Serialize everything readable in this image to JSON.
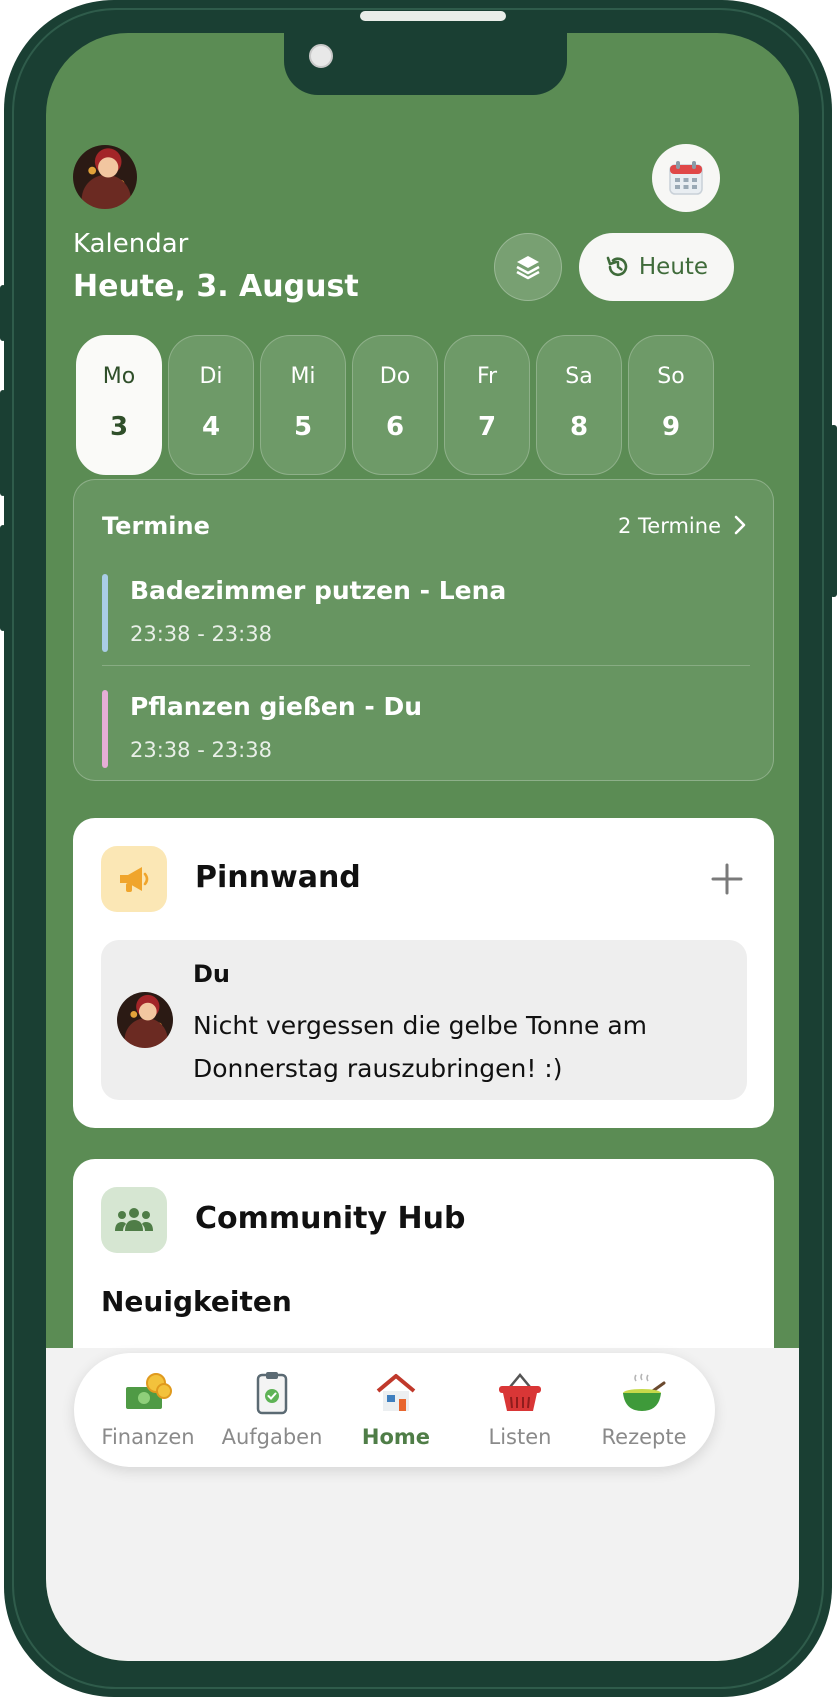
{
  "header": {
    "section_label": "Kalendar",
    "date_label": "Heute, 3. August",
    "today_button": "Heute",
    "icons": {
      "calendar": "calendar-icon",
      "layers": "layers-icon",
      "history": "history-icon"
    }
  },
  "days": [
    {
      "name": "Mo",
      "num": "3",
      "active": true
    },
    {
      "name": "Di",
      "num": "4"
    },
    {
      "name": "Mi",
      "num": "5"
    },
    {
      "name": "Do",
      "num": "6"
    },
    {
      "name": "Fr",
      "num": "7"
    },
    {
      "name": "Sa",
      "num": "8"
    },
    {
      "name": "So",
      "num": "9"
    }
  ],
  "termine": {
    "title": "Termine",
    "count": "2 Termine",
    "events": [
      {
        "title": "Badezimmer putzen - Lena",
        "time": "23:38 - 23:38",
        "color": "#a9cde6"
      },
      {
        "title": "Pflanzen gießen - Du",
        "time": "23:38 - 23:38",
        "color": "#e6aed6"
      }
    ]
  },
  "pinnwand": {
    "title": "Pinnwand",
    "post": {
      "author": "Du",
      "text": "Nicht vergessen die gelbe Tonne am Donnerstag rauszubringen! :)"
    }
  },
  "community": {
    "title": "Community Hub",
    "subtitle": "Neuigkeiten"
  },
  "nav": [
    {
      "label": "Finanzen",
      "icon": "money-icon"
    },
    {
      "label": "Aufgaben",
      "icon": "clipboard-check-icon"
    },
    {
      "label": "Home",
      "icon": "house-icon",
      "active": true
    },
    {
      "label": "Listen",
      "icon": "basket-icon"
    },
    {
      "label": "Rezepte",
      "icon": "soup-bowl-icon"
    }
  ],
  "colors": {
    "background": "#5b8c54",
    "frame": "#1a3f33",
    "accent": "#4f7d47"
  }
}
